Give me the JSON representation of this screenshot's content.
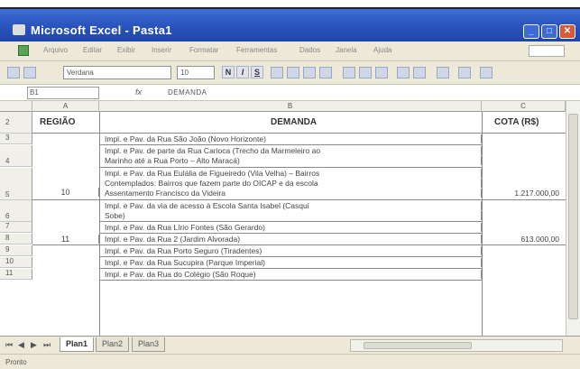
{
  "window": {
    "title": "Microsoft Excel - Pasta1",
    "minimize": "_",
    "maximize": "□",
    "close": "✕"
  },
  "menubar": {
    "items": [
      "Arquivo",
      "Editar",
      "Exibir",
      "Inserir",
      "Formatar",
      "Ferramentas",
      "Dados",
      "Janela",
      "Ajuda"
    ]
  },
  "toolbar": {
    "font": "Verdana",
    "size": "10",
    "bold": "N",
    "italic": "I",
    "underline": "S"
  },
  "formula_bar": {
    "name_box": "B1",
    "fx": "fx",
    "content": "DEMANDA"
  },
  "columns": [
    "A",
    "B",
    "C"
  ],
  "header_row": {
    "row": "2",
    "regiao": "REGIÃO",
    "demanda": "DEMANDA",
    "cota": "COTA (R$)"
  },
  "rows": [
    {
      "num": "3",
      "demanda": "Impl. e Pav. da Rua São João (Novo Horizonte)"
    },
    {
      "num": "",
      "demanda": "Impl. e Pav. de parte da Rua Carioca (Trecho da Marmeleiro ao"
    },
    {
      "num": "4",
      "demanda": "Marinho até a Rua Porto – Alto Maracá)"
    },
    {
      "num": "",
      "demanda": "Impl. e Pav. da Rua Eulália de Figueiredo (Vila Velha) – Bairros"
    },
    {
      "num": "",
      "demanda": "Contemplados: Bairros que fazem parte do OICAP e da escola"
    },
    {
      "num": "5",
      "demanda": "Assentamento Francisco da Videira"
    },
    {
      "num": "",
      "demanda": "Impl. e Pav. da via de acesso à Escola Santa Isabel (Casqui"
    },
    {
      "num": "6",
      "demanda": "Sobe)"
    },
    {
      "num": "7",
      "demanda": "Impl. e Pav. da Rua Lírio Fontes (São Gerardo)"
    },
    {
      "num": "8",
      "demanda": "Impl. e Pav. da Rua 2 (Jardim Alvorada)"
    },
    {
      "num": "9",
      "demanda": "Impl. e Pav. da Rua Porto Seguro (Tiradentes)"
    },
    {
      "num": "10",
      "demanda": "Impl. e Pav. da Rua Sucupira (Parque Imperial)"
    },
    {
      "num": "11",
      "demanda": "Impl. e Pav. da Rua do Colégio (São Roque)"
    }
  ],
  "regioes": [
    {
      "label": "10",
      "cota": "1.217.000,00"
    },
    {
      "label": "11",
      "cota": "613.000,00"
    }
  ],
  "sheet_tabs": {
    "tabs": [
      "Plan1",
      "Plan2",
      "Plan3"
    ],
    "active": "Plan1"
  },
  "nav": {
    "first": "⏮",
    "prev": "◀",
    "next": "▶",
    "last": "⏭"
  },
  "status": {
    "text": "Pronto"
  }
}
